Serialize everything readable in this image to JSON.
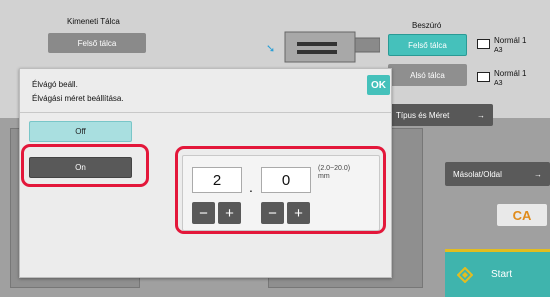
{
  "background": {
    "output_tray_label": "Kimeneti Tálca",
    "output_tray_value": "Felső tálca",
    "insert_label": "Beszúró",
    "upper_tray_button": "Felső tálca",
    "lower_tray_button": "Alsó tálca",
    "paper_upper": {
      "type": "Normál 1",
      "size": "A3"
    },
    "paper_lower": {
      "type": "Normál 1",
      "size": "A3"
    },
    "type_size_button": "Típus és Méret",
    "copy_side_button": "Másolat/Oldal",
    "ca_button": "CA",
    "start_button": "Start"
  },
  "dialog": {
    "title": "Élvágó beáll.",
    "subtitle": "Élvágási méret beállítása.",
    "ok_label": "OK",
    "option_off": "Off",
    "option_on": "On",
    "selected_option": "On",
    "integer_value": "2",
    "decimal_separator": ".",
    "decimal_value": "0",
    "range_text": "(2.0~20.0)",
    "unit": "mm",
    "minus_label": "−",
    "plus_label": "+"
  },
  "colors": {
    "accent_teal": "#45c1bb",
    "highlight_red": "#e3173a",
    "clear_orange": "#e08b1a"
  }
}
